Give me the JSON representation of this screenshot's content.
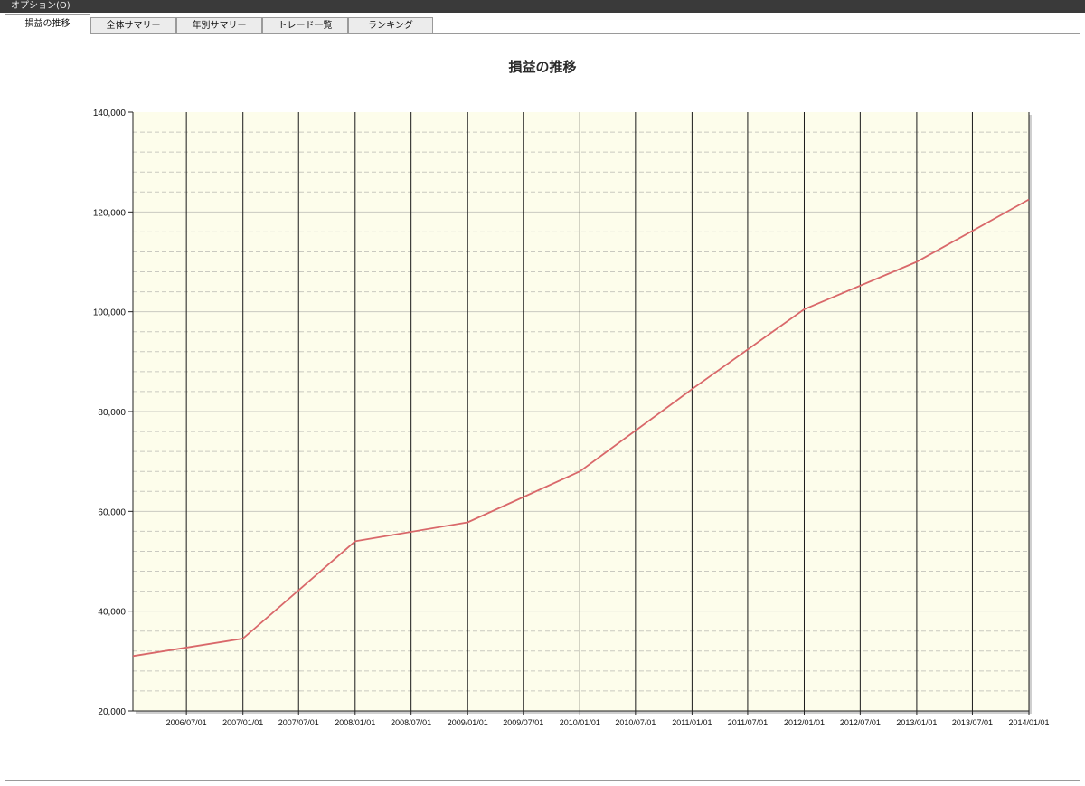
{
  "menu": {
    "options_label": "オプション(O)"
  },
  "tabs": [
    {
      "label": "損益の推移",
      "active": true
    },
    {
      "label": "全体サマリー",
      "active": false
    },
    {
      "label": "年別サマリー",
      "active": false
    },
    {
      "label": "トレード一覧",
      "active": false
    },
    {
      "label": "ランキング",
      "active": false
    }
  ],
  "colors": {
    "plot_background": "#fdfdeb",
    "line": "#d9686a",
    "major_grid": "#1a1a1a",
    "minor_grid": "#c9c9c0"
  },
  "chart_data": {
    "type": "line",
    "title": "損益の推移",
    "xlabel": "",
    "ylabel": "",
    "ylim": [
      20000,
      140000
    ],
    "xlim": [
      "2006-01-08",
      "2014-01-01"
    ],
    "y_major_ticks": [
      20000,
      40000,
      60000,
      80000,
      100000,
      120000,
      140000
    ],
    "y_tick_labels": [
      "20,000",
      "40,000",
      "60,000",
      "80,000",
      "100,000",
      "120,000",
      "140,000"
    ],
    "y_minor_step": 4000,
    "x_ticks": [
      "2006-07-01",
      "2007-01-01",
      "2007-07-01",
      "2008-01-01",
      "2008-07-01",
      "2009-01-01",
      "2009-07-01",
      "2010-01-01",
      "2010-07-01",
      "2011-01-01",
      "2011-07-01",
      "2012-01-01",
      "2012-07-01",
      "2013-01-01",
      "2013-07-01",
      "2014-01-01"
    ],
    "x_tick_labels": [
      "2006/07/01",
      "2007/01/01",
      "2007/07/01",
      "2008/01/01",
      "2008/07/01",
      "2009/01/01",
      "2009/07/01",
      "2010/01/01",
      "2010/07/01",
      "2011/01/01",
      "2011/07/01",
      "2012/01/01",
      "2012/07/01",
      "2013/01/01",
      "2013/07/01",
      "2014/01/01"
    ],
    "grid": true,
    "legend": "none",
    "series": [
      {
        "x": [
          "2006-01-08",
          "2007-01-01",
          "2008-01-01",
          "2009-01-01",
          "2010-01-01",
          "2011-01-01",
          "2012-01-01",
          "2013-01-01",
          "2014-01-01"
        ],
        "values": [
          31000,
          34500,
          54000,
          57800,
          68000,
          84500,
          100500,
          110000,
          122500
        ]
      }
    ]
  }
}
